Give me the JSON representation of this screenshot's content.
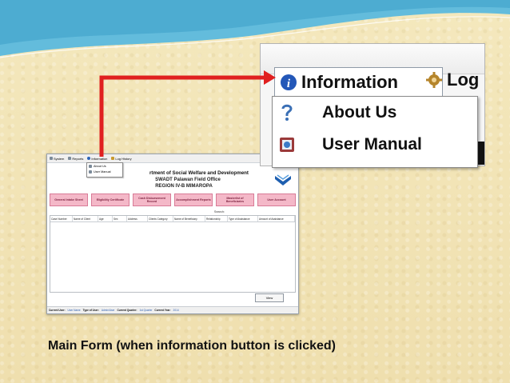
{
  "app": {
    "menu": [
      "System",
      "Reports",
      "Information",
      "Log History"
    ],
    "dropdown": [
      "About Us",
      "User Manual"
    ],
    "header": {
      "line1": "rtment of Social Welfare and Development",
      "line2": "SWADT Palawan Field Office",
      "line3": "REGION IV-B MIMAROPA"
    },
    "buttons": [
      "General Intake Sheet",
      "Eligibility Certificate",
      "Cash Disbursement Record",
      "Accomplishment Reports",
      "Masterlist of Beneficiaries",
      "User Account"
    ],
    "search_label": "Search:",
    "columns": [
      "Case Number",
      "Name of Client",
      "Age",
      "Sex",
      "Address",
      "Clients Category",
      "Name of Beneficiary",
      "Relationship",
      "Type of Assistance",
      "Amount of Assistance"
    ],
    "view_button": "View",
    "status": {
      "user_label": "Current User:",
      "user_value": "User Name",
      "type_label": "Type of User:",
      "type_value": "Admin/User",
      "quarter_label": "Current Quarter:",
      "quarter_value": "1st Quarter",
      "year_label": "Current Year:",
      "year_value": "2014"
    }
  },
  "zoom": {
    "menu_information": "Information",
    "menu_log": "Log",
    "items": [
      "About Us",
      "User Manual"
    ]
  },
  "caption": "Main Form (when information button is clicked)",
  "colors": {
    "arrow": "#e02020",
    "button_fill": "#f4b8c8",
    "swoosh": "#5bb8d8"
  }
}
